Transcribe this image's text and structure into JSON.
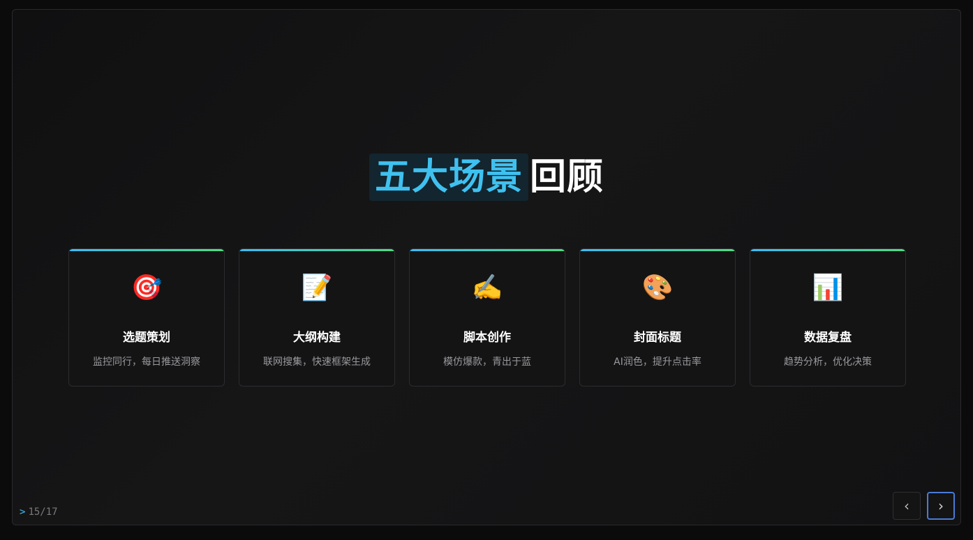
{
  "slide": {
    "title_highlight": "五大场景",
    "title_rest": "回顾",
    "cards": [
      {
        "icon": "🎯",
        "icon_name": "target-icon",
        "title": "选题策划",
        "desc": "监控同行，每日推送洞察"
      },
      {
        "icon": "📝",
        "icon_name": "memo-icon",
        "title": "大纲构建",
        "desc": "联网搜集，快速框架生成"
      },
      {
        "icon": "✍️",
        "icon_name": "writing-hand-icon",
        "title": "脚本创作",
        "desc": "模仿爆款，青出于蓝"
      },
      {
        "icon": "🎨",
        "icon_name": "palette-icon",
        "title": "封面标题",
        "desc": "AI润色，提升点击率"
      },
      {
        "icon": "📊",
        "icon_name": "bar-chart-icon",
        "title": "数据复盘",
        "desc": "趋势分析，优化决策"
      }
    ]
  },
  "pager": {
    "prompt": ">",
    "page": "15/17"
  },
  "nav": {
    "prev": "‹",
    "next": "›"
  },
  "colors": {
    "accent": "#3fc1f0",
    "gradient_start": "#38bdf8",
    "gradient_end": "#4ade80"
  }
}
